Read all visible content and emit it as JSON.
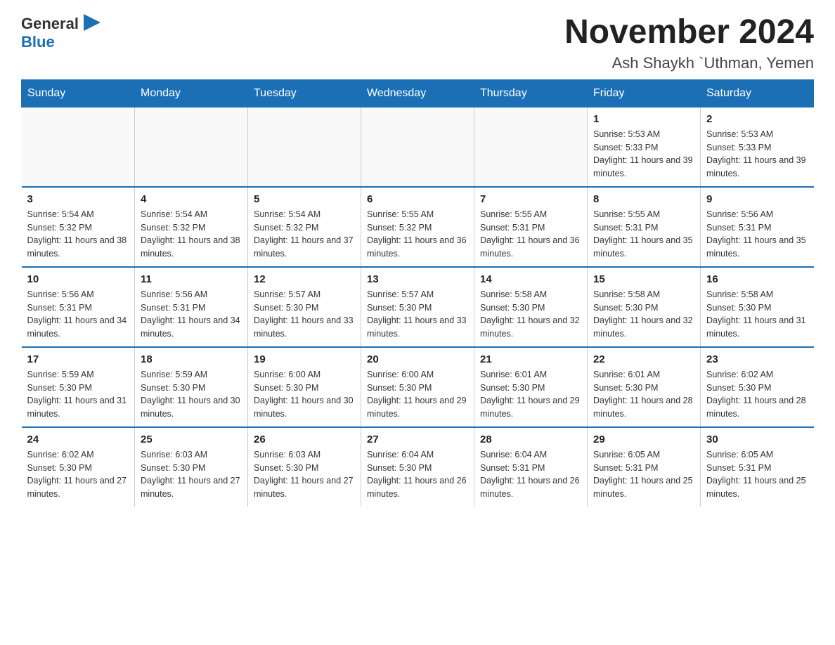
{
  "logo": {
    "general": "General",
    "blue": "Blue",
    "arrow_unicode": "▶"
  },
  "title": "November 2024",
  "subtitle": "Ash Shaykh `Uthman, Yemen",
  "days_of_week": [
    "Sunday",
    "Monday",
    "Tuesday",
    "Wednesday",
    "Thursday",
    "Friday",
    "Saturday"
  ],
  "weeks": [
    [
      {
        "day": "",
        "sunrise": "",
        "sunset": "",
        "daylight": ""
      },
      {
        "day": "",
        "sunrise": "",
        "sunset": "",
        "daylight": ""
      },
      {
        "day": "",
        "sunrise": "",
        "sunset": "",
        "daylight": ""
      },
      {
        "day": "",
        "sunrise": "",
        "sunset": "",
        "daylight": ""
      },
      {
        "day": "",
        "sunrise": "",
        "sunset": "",
        "daylight": ""
      },
      {
        "day": "1",
        "sunrise": "Sunrise: 5:53 AM",
        "sunset": "Sunset: 5:33 PM",
        "daylight": "Daylight: 11 hours and 39 minutes."
      },
      {
        "day": "2",
        "sunrise": "Sunrise: 5:53 AM",
        "sunset": "Sunset: 5:33 PM",
        "daylight": "Daylight: 11 hours and 39 minutes."
      }
    ],
    [
      {
        "day": "3",
        "sunrise": "Sunrise: 5:54 AM",
        "sunset": "Sunset: 5:32 PM",
        "daylight": "Daylight: 11 hours and 38 minutes."
      },
      {
        "day": "4",
        "sunrise": "Sunrise: 5:54 AM",
        "sunset": "Sunset: 5:32 PM",
        "daylight": "Daylight: 11 hours and 38 minutes."
      },
      {
        "day": "5",
        "sunrise": "Sunrise: 5:54 AM",
        "sunset": "Sunset: 5:32 PM",
        "daylight": "Daylight: 11 hours and 37 minutes."
      },
      {
        "day": "6",
        "sunrise": "Sunrise: 5:55 AM",
        "sunset": "Sunset: 5:32 PM",
        "daylight": "Daylight: 11 hours and 36 minutes."
      },
      {
        "day": "7",
        "sunrise": "Sunrise: 5:55 AM",
        "sunset": "Sunset: 5:31 PM",
        "daylight": "Daylight: 11 hours and 36 minutes."
      },
      {
        "day": "8",
        "sunrise": "Sunrise: 5:55 AM",
        "sunset": "Sunset: 5:31 PM",
        "daylight": "Daylight: 11 hours and 35 minutes."
      },
      {
        "day": "9",
        "sunrise": "Sunrise: 5:56 AM",
        "sunset": "Sunset: 5:31 PM",
        "daylight": "Daylight: 11 hours and 35 minutes."
      }
    ],
    [
      {
        "day": "10",
        "sunrise": "Sunrise: 5:56 AM",
        "sunset": "Sunset: 5:31 PM",
        "daylight": "Daylight: 11 hours and 34 minutes."
      },
      {
        "day": "11",
        "sunrise": "Sunrise: 5:56 AM",
        "sunset": "Sunset: 5:31 PM",
        "daylight": "Daylight: 11 hours and 34 minutes."
      },
      {
        "day": "12",
        "sunrise": "Sunrise: 5:57 AM",
        "sunset": "Sunset: 5:30 PM",
        "daylight": "Daylight: 11 hours and 33 minutes."
      },
      {
        "day": "13",
        "sunrise": "Sunrise: 5:57 AM",
        "sunset": "Sunset: 5:30 PM",
        "daylight": "Daylight: 11 hours and 33 minutes."
      },
      {
        "day": "14",
        "sunrise": "Sunrise: 5:58 AM",
        "sunset": "Sunset: 5:30 PM",
        "daylight": "Daylight: 11 hours and 32 minutes."
      },
      {
        "day": "15",
        "sunrise": "Sunrise: 5:58 AM",
        "sunset": "Sunset: 5:30 PM",
        "daylight": "Daylight: 11 hours and 32 minutes."
      },
      {
        "day": "16",
        "sunrise": "Sunrise: 5:58 AM",
        "sunset": "Sunset: 5:30 PM",
        "daylight": "Daylight: 11 hours and 31 minutes."
      }
    ],
    [
      {
        "day": "17",
        "sunrise": "Sunrise: 5:59 AM",
        "sunset": "Sunset: 5:30 PM",
        "daylight": "Daylight: 11 hours and 31 minutes."
      },
      {
        "day": "18",
        "sunrise": "Sunrise: 5:59 AM",
        "sunset": "Sunset: 5:30 PM",
        "daylight": "Daylight: 11 hours and 30 minutes."
      },
      {
        "day": "19",
        "sunrise": "Sunrise: 6:00 AM",
        "sunset": "Sunset: 5:30 PM",
        "daylight": "Daylight: 11 hours and 30 minutes."
      },
      {
        "day": "20",
        "sunrise": "Sunrise: 6:00 AM",
        "sunset": "Sunset: 5:30 PM",
        "daylight": "Daylight: 11 hours and 29 minutes."
      },
      {
        "day": "21",
        "sunrise": "Sunrise: 6:01 AM",
        "sunset": "Sunset: 5:30 PM",
        "daylight": "Daylight: 11 hours and 29 minutes."
      },
      {
        "day": "22",
        "sunrise": "Sunrise: 6:01 AM",
        "sunset": "Sunset: 5:30 PM",
        "daylight": "Daylight: 11 hours and 28 minutes."
      },
      {
        "day": "23",
        "sunrise": "Sunrise: 6:02 AM",
        "sunset": "Sunset: 5:30 PM",
        "daylight": "Daylight: 11 hours and 28 minutes."
      }
    ],
    [
      {
        "day": "24",
        "sunrise": "Sunrise: 6:02 AM",
        "sunset": "Sunset: 5:30 PM",
        "daylight": "Daylight: 11 hours and 27 minutes."
      },
      {
        "day": "25",
        "sunrise": "Sunrise: 6:03 AM",
        "sunset": "Sunset: 5:30 PM",
        "daylight": "Daylight: 11 hours and 27 minutes."
      },
      {
        "day": "26",
        "sunrise": "Sunrise: 6:03 AM",
        "sunset": "Sunset: 5:30 PM",
        "daylight": "Daylight: 11 hours and 27 minutes."
      },
      {
        "day": "27",
        "sunrise": "Sunrise: 6:04 AM",
        "sunset": "Sunset: 5:30 PM",
        "daylight": "Daylight: 11 hours and 26 minutes."
      },
      {
        "day": "28",
        "sunrise": "Sunrise: 6:04 AM",
        "sunset": "Sunset: 5:31 PM",
        "daylight": "Daylight: 11 hours and 26 minutes."
      },
      {
        "day": "29",
        "sunrise": "Sunrise: 6:05 AM",
        "sunset": "Sunset: 5:31 PM",
        "daylight": "Daylight: 11 hours and 25 minutes."
      },
      {
        "day": "30",
        "sunrise": "Sunrise: 6:05 AM",
        "sunset": "Sunset: 5:31 PM",
        "daylight": "Daylight: 11 hours and 25 minutes."
      }
    ]
  ]
}
